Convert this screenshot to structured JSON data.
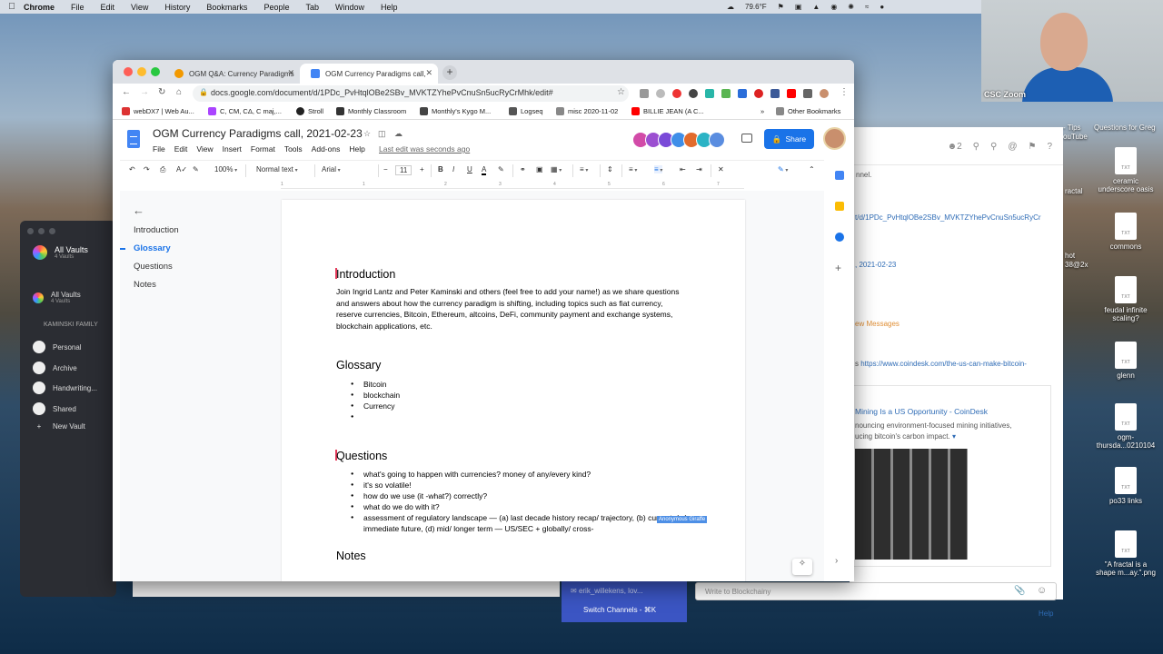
{
  "menubar": {
    "app": "Chrome",
    "items": [
      "File",
      "Edit",
      "View",
      "History",
      "Bookmarks",
      "People",
      "Tab",
      "Window",
      "Help"
    ],
    "weather": "79.6°F"
  },
  "zoom": {
    "label": "CSC Zoom"
  },
  "desktop": {
    "top_labels": [
      "- Tips",
      "ouTube",
      "Questions for Greg"
    ],
    "icons": [
      {
        "label": "ceramic underscore oasis"
      },
      {
        "label": "commons"
      },
      {
        "label": "feudal infinite scaling?"
      },
      {
        "label": "glenn"
      },
      {
        "label": "ogm-thursda...0210104"
      },
      {
        "label": "po33 links"
      },
      {
        "label": "\"A fractal is a shape m...ay.\".png"
      }
    ],
    "left_labels": [
      "ractal",
      "hot",
      "38@2x"
    ]
  },
  "vault": {
    "all_vaults": "All Vaults",
    "all_vaults_count": "4 Vaults",
    "selected": "All Vaults",
    "selected_count": "4 Vaults",
    "family": "KAMINSKI FAMILY",
    "items": [
      "Personal",
      "Archive",
      "Handwriting...",
      "Shared",
      "New Vault"
    ]
  },
  "chat": {
    "header_count": "2",
    "line1": "nnel.",
    "link1": "t/d/1PDc_PvHtqlOBe2SBv_MVKTZYhePvCnuSn5ucRyCr",
    "link2": ", 2021-02-23",
    "new_messages": "ew Messages",
    "link3_prefix": "s",
    "link3": "https://www.coindesk.com/the-us-can-make-bitcoin-",
    "card_title": "Mining Is a US Opportunity - CoinDesk",
    "card_text1": "nouncing environment-focused mining initiatives,",
    "card_text2": "ucing bitcoin's carbon impact.",
    "compose_placeholder": "Write to Blockchainy",
    "recipient": "erik_willekens, lov...",
    "switch_channels": "Switch Channels - ⌘K",
    "help": "Help"
  },
  "chrome": {
    "tabs": [
      {
        "title": "OGM Q&A: Currency Paradigms",
        "active": false
      },
      {
        "title": "OGM Currency Paradigms call,",
        "active": true
      }
    ],
    "url": "docs.google.com/document/d/1PDc_PvHtqlOBe2SBv_MVKTZYhePvCnuSn5ucRyCrMhk/edit#",
    "bookmarks": [
      "webDX7 | Web Au...",
      "C, CM, CΔ, C maj,...",
      "Stroll",
      "Monthly Classroom",
      "Monthly's Kygo M...",
      "Logseq",
      "misc 2020-11-02",
      "BILLIE JEAN (A C..."
    ],
    "bookmarks_more": "»",
    "other_bookmarks": "Other Bookmarks"
  },
  "docs": {
    "title": "OGM Currency Paradigms call, 2021-02-23",
    "menus": [
      "File",
      "Edit",
      "View",
      "Insert",
      "Format",
      "Tools",
      "Add-ons",
      "Help"
    ],
    "last_edit": "Last edit was seconds ago",
    "share": "Share",
    "toolbar": {
      "zoom": "100%",
      "style": "Normal text",
      "font": "Arial",
      "size": "11"
    },
    "ruler": [
      "1",
      "1",
      "2",
      "3",
      "4",
      "5",
      "6",
      "7"
    ],
    "outline": [
      {
        "label": "Introduction",
        "active": false
      },
      {
        "label": "Glossary",
        "active": true
      },
      {
        "label": "Questions",
        "active": false
      },
      {
        "label": "Notes",
        "active": false
      }
    ],
    "content": {
      "intro_heading": "Introduction",
      "intro_body": "Join Ingrid Lantz and Peter Kaminski and others (feel free to add your name!) as we share questions and answers about how the currency paradigm is shifting, including topics such as fiat currency, reserve currencies, Bitcoin, Ethereum, altcoins, DeFi, community payment and exchange systems, blockchain applications, etc.",
      "glossary_heading": "Glossary",
      "glossary_items": [
        "Bitcoin",
        "blockchain",
        "Currency",
        ""
      ],
      "questions_heading": "Questions",
      "question_items": [
        "what's going to happen with currencies? money of any/every kind?",
        "it's so volatile!",
        "how do we use (it -what?) correctly?",
        "what do we do with it?",
        "assessment of regulatory landscape — (a) last decade history recap/ trajectory, (b) current, (c ) immediate future, (d) mid/ longer term — US/SEC + globally/ cross-"
      ],
      "cursor_label": "Anonymous Giraffe",
      "notes_heading": "Notes"
    }
  }
}
